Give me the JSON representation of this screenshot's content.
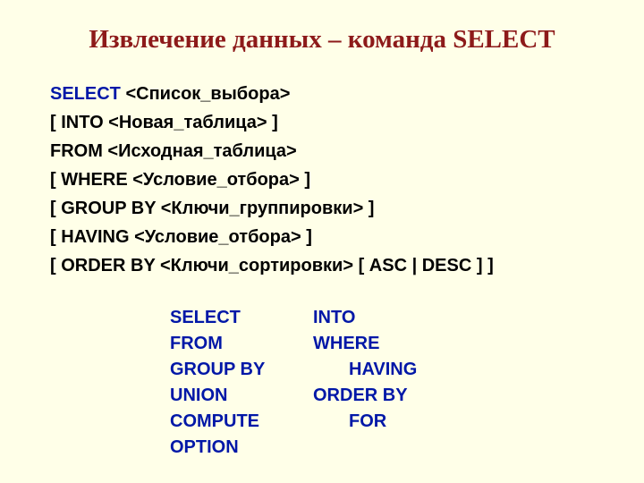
{
  "title": "Извлечение данных – команда SELECT",
  "syntax": {
    "l1_kw": "SELECT",
    "l1_txt": " <Список_выбора>",
    "l2": "[ INTO <Новая_таблица> ]",
    "l3": "FROM <Исходная_таблица>",
    "l4": "[ WHERE <Условие_отбора> ]",
    "l5": "[ GROUP BY <Ключи_группировки> ]",
    "l6": "[ HAVING <Условие_отбора> ]",
    "l7": "[ ORDER BY <Ключи_сортировки> [ ASC | DESC ] ]"
  },
  "keywords": {
    "r1c1": "SELECT",
    "r1c2": "INTO",
    "r2c1": "FROM",
    "r2c2": "WHERE",
    "r3c1": "GROUP BY",
    "r3c2": "HAVING",
    "r4c1": "UNION",
    "r4c2": "ORDER BY",
    "r5c1": "COMPUTE",
    "r5c2": "FOR",
    "r6c1": "OPTION"
  }
}
